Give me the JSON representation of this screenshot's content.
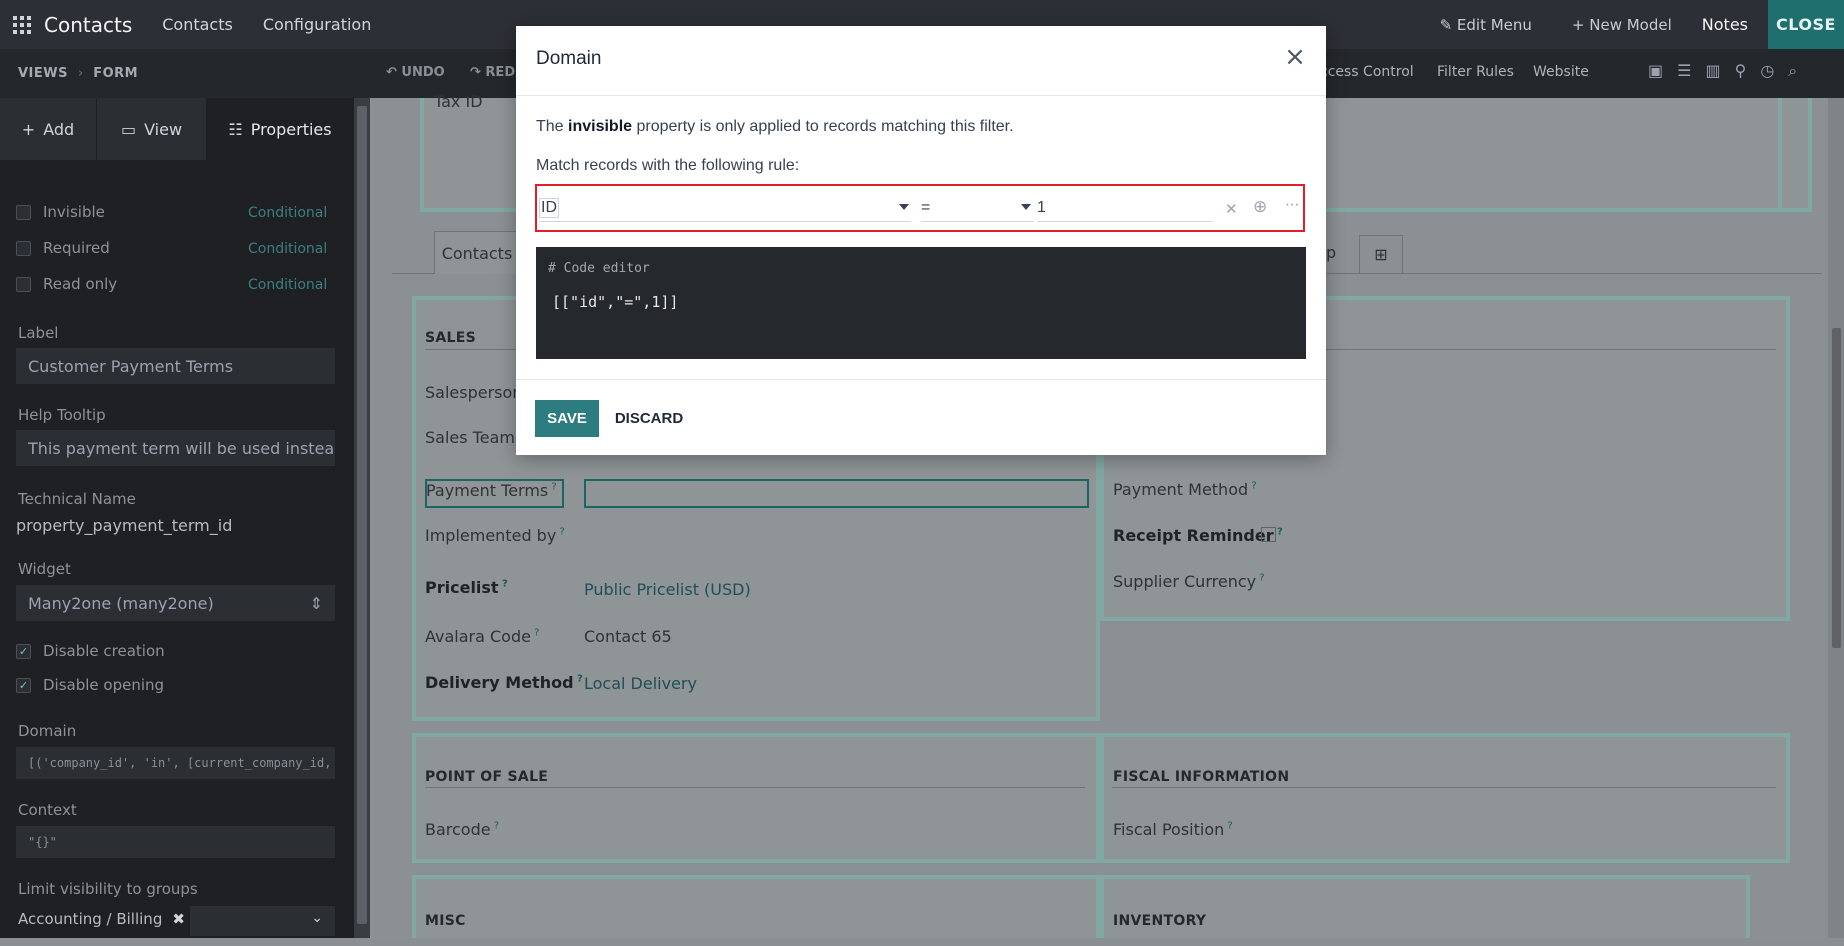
{
  "topbar": {
    "apps_icon": "grid-icon",
    "brand": "Contacts",
    "menu": [
      "Contacts",
      "Configuration"
    ],
    "edit_menu": "Edit Menu",
    "new_model": "New Model",
    "notes": "Notes",
    "close": "CLOSE"
  },
  "subbar": {
    "crumb1": "VIEWS",
    "crumb2": "FORM",
    "undo": "UNDO",
    "redo": "RED",
    "access_control": "ccess Control",
    "filter_rules": "Filter Rules",
    "website": "Website"
  },
  "sidebar": {
    "tabs": [
      "Add",
      "View",
      "Properties"
    ],
    "checks": [
      {
        "label": "Invisible",
        "cond": "Conditional",
        "checked": false
      },
      {
        "label": "Required",
        "cond": "Conditional",
        "checked": false
      },
      {
        "label": "Read only",
        "cond": "Conditional",
        "checked": false
      }
    ],
    "label_title": "Label",
    "label_value": "Customer Payment Terms",
    "help_title": "Help Tooltip",
    "help_value": "This payment term will be used instead o",
    "tech_title": "Technical Name",
    "tech_value": "property_payment_term_id",
    "widget_title": "Widget",
    "widget_value": "Many2one (many2one)",
    "disable_creation": "Disable creation",
    "disable_opening": "Disable opening",
    "domain_title": "Domain",
    "domain_value": "[('company_id', 'in', [current_company_id,",
    "context_title": "Context",
    "context_value": "\"{}\"",
    "groups_title": "Limit visibility to groups",
    "groups_tag": "Accounting / Billing"
  },
  "form": {
    "tax_id": "Tax ID",
    "tab_contacts": "Contacts",
    "tab_partial": "p",
    "sales": "SALES",
    "salesperson": "Salesperson",
    "sales_team": "Sales Team",
    "payment_terms": "Payment Terms",
    "implemented_by": "Implemented by",
    "pricelist": "Pricelist",
    "pricelist_value": "Public Pricelist (USD)",
    "avalara": "Avalara Code",
    "avalara_value": "Contact 65",
    "delivery": "Delivery Method",
    "delivery_value": "Local Delivery",
    "payment_method": "Payment Method",
    "receipt_reminder": "Receipt Reminder",
    "supplier_currency": "Supplier Currency",
    "pos": "POINT OF SALE",
    "barcode": "Barcode",
    "fiscal_info": "FISCAL INFORMATION",
    "fiscal_position": "Fiscal Position",
    "misc": "MISC",
    "inventory": "INVENTORY"
  },
  "modal": {
    "title": "Domain",
    "desc_pre": "The ",
    "desc_bold": "invisible",
    "desc_post": " property is only applied to records matching this filter.",
    "match_text": "Match records with the following rule:",
    "field": "ID",
    "operator": "=",
    "value": "1",
    "code_comment": "# Code editor",
    "code_value": "[[\"id\",\"=\",1]]",
    "save": "SAVE",
    "discard": "DISCARD"
  },
  "colors": {
    "accent": "#2d7c80",
    "rule_border": "#e11d2a",
    "topbar": "#2c2f35"
  }
}
